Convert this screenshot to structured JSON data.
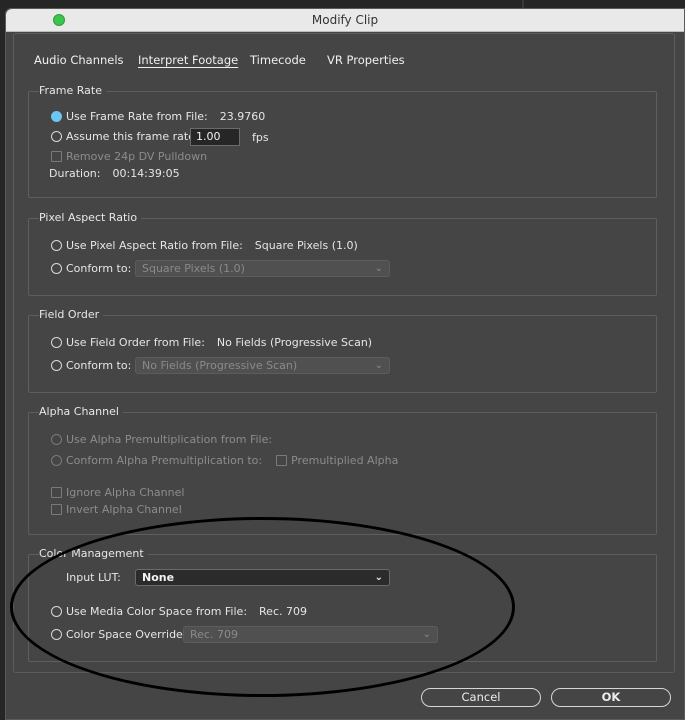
{
  "window": {
    "title": "Modify Clip"
  },
  "tabs": [
    {
      "label": "Audio Channels"
    },
    {
      "label": "Interpret Footage"
    },
    {
      "label": "Timecode"
    },
    {
      "label": "VR Properties"
    }
  ],
  "frame_rate": {
    "heading": "Frame Rate",
    "use_from_file_label": "Use Frame Rate from File:",
    "use_from_file_value": "23.9760",
    "assume_label": "Assume this frame rate:",
    "assume_value": "1.00",
    "fps_unit": "fps",
    "remove_pulldown_label": "Remove 24p DV Pulldown",
    "duration_label": "Duration:",
    "duration_value": "00:14:39:05"
  },
  "pixel_aspect": {
    "heading": "Pixel Aspect Ratio",
    "use_from_file_label": "Use Pixel Aspect Ratio from File:",
    "use_from_file_value": "Square Pixels (1.0)",
    "conform_label": "Conform to:",
    "conform_value": "Square Pixels (1.0)"
  },
  "field_order": {
    "heading": "Field Order",
    "use_from_file_label": "Use Field Order from File:",
    "use_from_file_value": "No Fields (Progressive Scan)",
    "conform_label": "Conform to:",
    "conform_value": "No Fields (Progressive Scan)"
  },
  "alpha": {
    "heading": "Alpha Channel",
    "use_premult_label": "Use Alpha Premultiplication from File:",
    "conform_premult_label": "Conform Alpha Premultiplication to:",
    "premultiplied_label": "Premultiplied Alpha",
    "ignore_label": "Ignore Alpha Channel",
    "invert_label": "Invert Alpha Channel"
  },
  "color": {
    "heading": "Color Management",
    "input_lut_label": "Input LUT:",
    "input_lut_value": "None",
    "use_media_label": "Use Media Color Space from File:",
    "use_media_value": "Rec. 709",
    "override_label": "Color Space Override:",
    "override_value": "Rec. 709"
  },
  "buttons": {
    "cancel": "Cancel",
    "ok": "OK"
  },
  "colors": {
    "accent": "#6bc6f2",
    "dialog_bg": "#454545",
    "annotation": "#000000"
  }
}
